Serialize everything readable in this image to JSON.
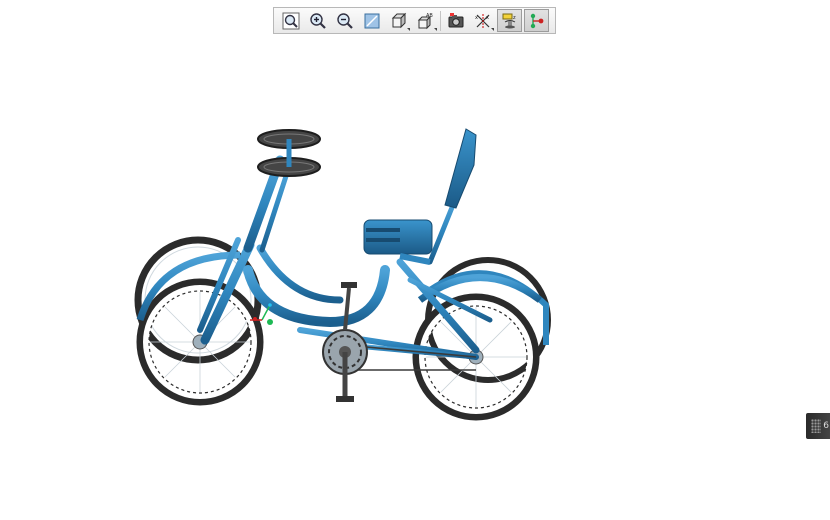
{
  "toolbar": {
    "buttons": [
      {
        "name": "zoom-fit-button",
        "icon": "zoom-fit-icon",
        "active": false
      },
      {
        "name": "zoom-in-button",
        "icon": "zoom-in-icon",
        "active": false
      },
      {
        "name": "zoom-out-button",
        "icon": "zoom-out-icon",
        "active": false
      },
      {
        "name": "repaint-button",
        "icon": "repaint-icon",
        "active": false
      },
      {
        "name": "display-style-button",
        "icon": "cube-icon",
        "active": false,
        "dropdown": true
      },
      {
        "name": "view-manager-button",
        "icon": "saved-views-icon",
        "active": false,
        "dropdown": true
      },
      {
        "name": "screenshot-button",
        "icon": "camera-icon",
        "active": false
      },
      {
        "name": "datum-display-button",
        "icon": "datum-axes-icon",
        "active": false,
        "dropdown": true
      },
      {
        "name": "spin-center-button",
        "icon": "spin-center-icon",
        "active": true
      },
      {
        "name": "annotation-display-button",
        "icon": "node-graph-icon",
        "active": true
      }
    ]
  },
  "side_panel": {
    "label": "6"
  },
  "colors": {
    "frame": "#2f86be",
    "frame_dark": "#1c5f8e",
    "tire": "#2b2b2b",
    "spoke": "#cfd8de",
    "toolbar_bg": "#ececec"
  }
}
